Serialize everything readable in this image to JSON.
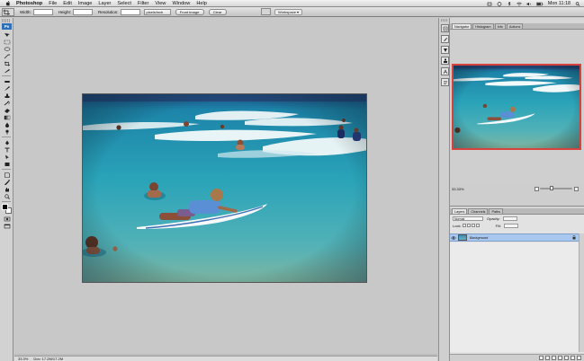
{
  "menubar": {
    "app_name": "Photoshop",
    "menus": [
      "File",
      "Edit",
      "Image",
      "Layer",
      "Select",
      "Filter",
      "View",
      "Window",
      "Help"
    ],
    "clock": "Mon 11:18"
  },
  "options_bar": {
    "width_label": "Width:",
    "height_label": "Height:",
    "resolution_label": "Resolution:",
    "resolution_unit": "pixels/inch",
    "front_image_label": "Front Image",
    "clear_label": "Clear",
    "workspace_label": "Workspace"
  },
  "tools": {
    "ps_label": "Ps",
    "items": [
      "move-icon",
      "marquee-icon",
      "lasso-icon",
      "magic-wand-icon",
      "crop-icon",
      "slice-icon",
      "healing-icon",
      "brush-icon",
      "stamp-icon",
      "history-brush-icon",
      "eraser-icon",
      "gradient-icon",
      "blur-icon",
      "dodge-icon",
      "pen-icon",
      "type-icon",
      "path-select-icon",
      "shape-icon",
      "notes-icon",
      "eyedropper-icon",
      "hand-icon",
      "zoom-icon"
    ]
  },
  "status_bar": {
    "zoom": "33.3%",
    "doc_info": "Doc: 17.2M/17.2M"
  },
  "navigator": {
    "tabs": [
      "Navigator",
      "Histogram",
      "Info",
      "Actions"
    ],
    "zoom": "33.33%"
  },
  "layers": {
    "tabs": [
      "Layers",
      "Channels",
      "Paths"
    ],
    "blend_mode": "Normal",
    "opacity_label": "Opacity:",
    "lock_label": "Lock:",
    "fill_label": "Fill:",
    "layer_name": "Background"
  },
  "colors": {
    "selection_highlight": "#a9c8ef",
    "navigator_frame": "#d8423c",
    "sea_blue": "#2f9bb6"
  }
}
